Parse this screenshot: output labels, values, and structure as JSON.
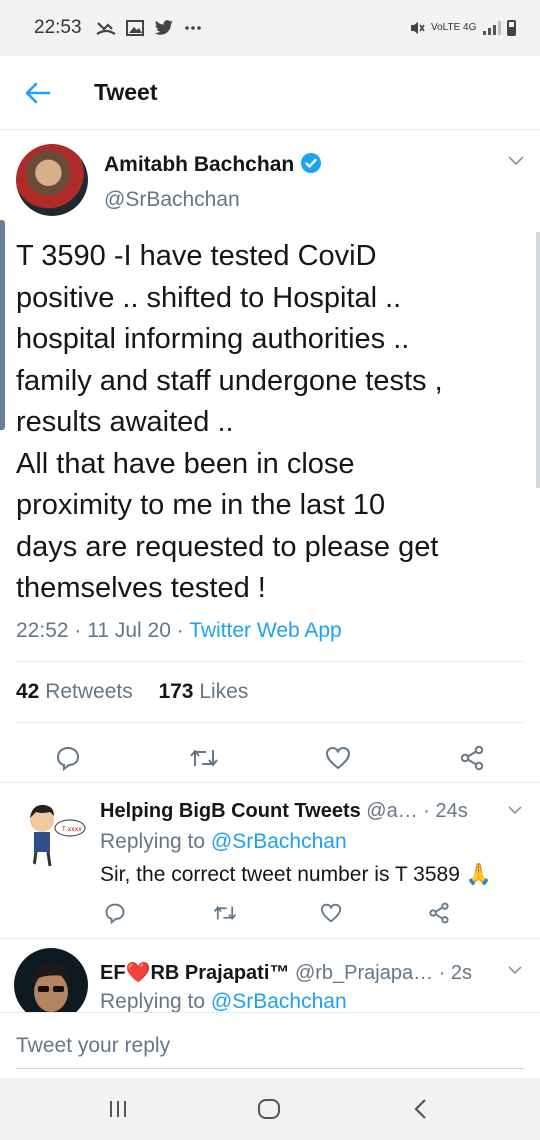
{
  "status_bar": {
    "time": "22:53",
    "icons": [
      "missed-call-icon",
      "gallery-icon",
      "twitter-icon",
      "more-dots-icon"
    ],
    "network_text": "VoLTE 4G",
    "right_icons": [
      "mute-icon",
      "signal-icon",
      "battery-icon"
    ]
  },
  "header": {
    "title": "Tweet",
    "back_icon": "back-arrow-icon"
  },
  "tweet": {
    "author_name": "Amitabh Bachchan",
    "author_handle": "@SrBachchan",
    "text": "T 3590 -I have tested CoviD\npositive ..  shifted to Hospital  ..\nhospital informing  authorities ..\nfamily and staff undergone tests ,\nresults awaited ..\nAll that have been in close\nproximity to me in the last 10\ndays are requested to please get\nthemselves tested !",
    "time": "22:52",
    "date": "11 Jul 20",
    "source": "Twitter Web App",
    "retweets_count": "42",
    "retweets_label": "Retweets",
    "likes_count": "173",
    "likes_label": "Likes",
    "actions": [
      "reply-icon",
      "retweet-icon",
      "like-icon",
      "share-icon"
    ]
  },
  "replies": [
    {
      "name": "Helping BigB Count Tweets",
      "handle": "@a…",
      "time": "· 24s",
      "replying_label": "Replying to",
      "replying_to": "@SrBachchan",
      "text": "Sir, the correct tweet number is T 3589 🙏"
    },
    {
      "name": "EF❤️RB Prajapati™",
      "handle": "@rb_Prajapa…",
      "time": "· 2s",
      "replying_label": "Replying to",
      "replying_to": "@SrBachchan"
    }
  ],
  "reply_box": {
    "placeholder": "Tweet your reply"
  },
  "colors": {
    "accent": "#1da1f2",
    "secondary_text": "#657786",
    "primary_text": "#14171a",
    "divider": "#e6ecf0"
  }
}
